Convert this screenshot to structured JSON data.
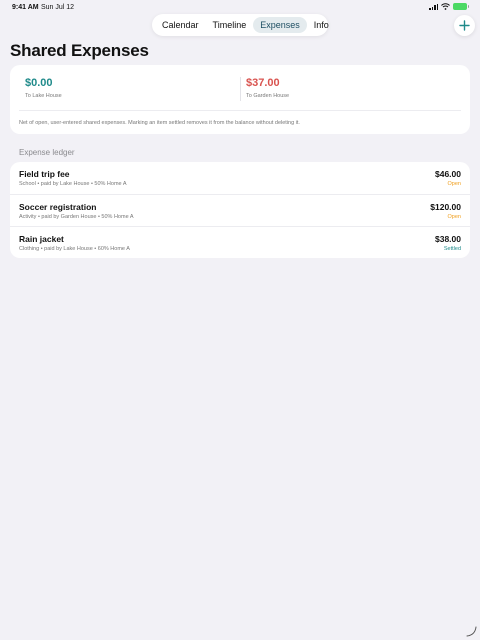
{
  "colors": {
    "accent": "#1f8a8a",
    "negative": "#d9534f",
    "open": "#f0a020",
    "settled": "#1f8a8a",
    "background": "#f2f1f6"
  },
  "status_bar": {
    "time": "9:41 AM",
    "date": "Sun Jul 12"
  },
  "tabs": [
    {
      "label": "Calendar",
      "active": false
    },
    {
      "label": "Timeline",
      "active": false
    },
    {
      "label": "Expenses",
      "active": true
    },
    {
      "label": "Info",
      "active": false
    }
  ],
  "add_button": {
    "icon": "plus-icon"
  },
  "page_title": "Shared Expenses",
  "balances": [
    {
      "amount": "$0.00",
      "label": "To Lake House"
    },
    {
      "amount": "$37.00",
      "label": "To Garden House"
    }
  ],
  "balance_note": "Net of open, user-entered shared expenses. Marking an item settled removes it from the balance without deleting it.",
  "ledger": {
    "title": "Expense ledger",
    "items": [
      {
        "title": "Field trip fee",
        "subtitle": "School • paid by Lake House • 50% Home A",
        "amount": "$46.00",
        "status": "Open"
      },
      {
        "title": "Soccer registration",
        "subtitle": "Activity • paid by Garden House • 50% Home A",
        "amount": "$120.00",
        "status": "Open"
      },
      {
        "title": "Rain jacket",
        "subtitle": "Clothing • paid by Lake House • 60% Home A",
        "amount": "$38.00",
        "status": "Settled"
      }
    ]
  }
}
